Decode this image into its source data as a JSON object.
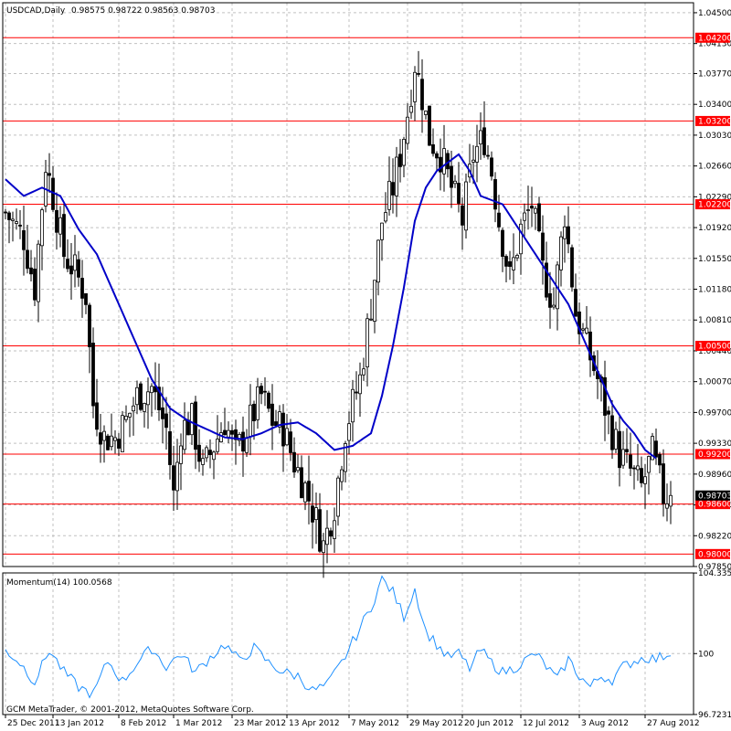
{
  "colors": {
    "background": "#ffffff",
    "grid": "#c0c0c0",
    "candle": "#000000",
    "moving_average": "#0000c8",
    "levels": "#ff0000",
    "momentum": "#1e90ff",
    "price_box": "#000000",
    "level_label_bg": "#ff0000",
    "level_label_text": "#ffffff"
  },
  "chart_data": [
    {
      "type": "candlestick",
      "title": "USDCAD,Daily",
      "ohlc_last": "0.98575 0.98722 0.98563 0.98703",
      "ylim": [
        0.9785,
        1.0462
      ],
      "y_ticks": [
        "1.04500",
        "1.04130",
        "1.03770",
        "1.03400",
        "1.03030",
        "1.02660",
        "1.02290",
        "1.01920",
        "1.01550",
        "1.01180",
        "1.00810",
        "1.00440",
        "1.00070",
        "0.99700",
        "0.99330",
        "0.98960",
        "0.98590",
        "0.98220",
        "0.97850"
      ],
      "x_ticks": [
        "25 Dec 2011",
        "13 Jan 2012",
        "8 Feb 2012",
        "1 Mar 2012",
        "23 Mar 2012",
        "13 Apr 2012",
        "7 May 2012",
        "29 May 2012",
        "20 Jun 2012",
        "12 Jul 2012",
        "3 Aug 2012",
        "27 Aug 2012"
      ],
      "x_tick_bar_index": [
        0,
        13,
        31,
        46,
        62,
        77,
        94,
        110,
        125,
        141,
        157,
        175
      ],
      "horizontal_levels": [
        {
          "value": 1.042,
          "label": "1.04200"
        },
        {
          "value": 1.032,
          "label": "1.03200"
        },
        {
          "value": 1.022,
          "label": "1.02200"
        },
        {
          "value": 1.005,
          "label": "1.00500"
        },
        {
          "value": 0.992,
          "label": "0.99200"
        },
        {
          "value": 0.986,
          "label": "0.98600"
        },
        {
          "value": 0.98,
          "label": "0.98000"
        }
      ],
      "current_price": {
        "value": 0.98703,
        "label": "0.98703"
      },
      "close_keypoints": [
        [
          0,
          1.021
        ],
        [
          5,
          1.018
        ],
        [
          8,
          1.012
        ],
        [
          11,
          1.027
        ],
        [
          13,
          1.023
        ],
        [
          16,
          1.016
        ],
        [
          19,
          1.014
        ],
        [
          22,
          1.011
        ],
        [
          24,
          0.998
        ],
        [
          27,
          0.994
        ],
        [
          30,
          0.994
        ],
        [
          33,
          0.996
        ],
        [
          36,
          0.999
        ],
        [
          40,
          1.0
        ],
        [
          44,
          0.995
        ],
        [
          46,
          0.987
        ],
        [
          48,
          0.995
        ],
        [
          51,
          0.996
        ],
        [
          54,
          0.99
        ],
        [
          57,
          0.993
        ],
        [
          60,
          0.996
        ],
        [
          63,
          0.992
        ],
        [
          66,
          0.995
        ],
        [
          70,
          0.999
        ],
        [
          73,
          0.996
        ],
        [
          76,
          0.995
        ],
        [
          79,
          0.991
        ],
        [
          82,
          0.988
        ],
        [
          85,
          0.984
        ],
        [
          87,
          0.981
        ],
        [
          90,
          0.986
        ],
        [
          93,
          0.995
        ],
        [
          97,
          1.001
        ],
        [
          100,
          1.01
        ],
        [
          103,
          1.02
        ],
        [
          106,
          1.024
        ],
        [
          108,
          1.028
        ],
        [
          110,
          1.033
        ],
        [
          112,
          1.039
        ],
        [
          114,
          1.035
        ],
        [
          116,
          1.03
        ],
        [
          119,
          1.028
        ],
        [
          122,
          1.024
        ],
        [
          125,
          1.02
        ],
        [
          128,
          1.028
        ],
        [
          131,
          1.03
        ],
        [
          133,
          1.026
        ],
        [
          135,
          1.02
        ],
        [
          138,
          1.013
        ],
        [
          141,
          1.019
        ],
        [
          144,
          1.022
        ],
        [
          147,
          1.014
        ],
        [
          150,
          1.01
        ],
        [
          153,
          1.021
        ],
        [
          156,
          1.009
        ],
        [
          159,
          1.005
        ],
        [
          162,
          1.001
        ],
        [
          165,
          0.996
        ],
        [
          168,
          0.992
        ],
        [
          171,
          0.99
        ],
        [
          174,
          0.988
        ],
        [
          177,
          0.992
        ],
        [
          180,
          0.987
        ],
        [
          182,
          0.98703
        ]
      ],
      "moving_average_keypoints": [
        [
          0,
          1.025
        ],
        [
          5,
          1.023
        ],
        [
          10,
          1.024
        ],
        [
          15,
          1.023
        ],
        [
          20,
          1.019
        ],
        [
          25,
          1.016
        ],
        [
          30,
          1.011
        ],
        [
          35,
          1.006
        ],
        [
          40,
          1.001
        ],
        [
          45,
          0.9975
        ],
        [
          50,
          0.996
        ],
        [
          55,
          0.995
        ],
        [
          60,
          0.994
        ],
        [
          65,
          0.9938
        ],
        [
          70,
          0.9945
        ],
        [
          75,
          0.9955
        ],
        [
          80,
          0.9958
        ],
        [
          85,
          0.9945
        ],
        [
          90,
          0.9925
        ],
        [
          95,
          0.993
        ],
        [
          100,
          0.9945
        ],
        [
          103,
          0.999
        ],
        [
          106,
          1.005
        ],
        [
          109,
          1.012
        ],
        [
          112,
          1.02
        ],
        [
          115,
          1.024
        ],
        [
          118,
          1.026
        ],
        [
          121,
          1.027
        ],
        [
          124,
          1.028
        ],
        [
          127,
          1.026
        ],
        [
          130,
          1.023
        ],
        [
          133,
          1.0225
        ],
        [
          136,
          1.022
        ],
        [
          139,
          1.02
        ],
        [
          142,
          1.018
        ],
        [
          145,
          1.016
        ],
        [
          148,
          1.014
        ],
        [
          151,
          1.012
        ],
        [
          154,
          1.01
        ],
        [
          157,
          1.007
        ],
        [
          160,
          1.004
        ],
        [
          163,
          1.001
        ],
        [
          166,
          0.998
        ],
        [
          169,
          0.996
        ],
        [
          172,
          0.9945
        ],
        [
          175,
          0.9925
        ],
        [
          178,
          0.9915
        ]
      ],
      "watermark": "GCM MetaTrader, © 2001-2012, MetaQuotes Software Corp."
    },
    {
      "type": "line",
      "title": "Momentum(14) 100.0568",
      "ylim": [
        96.72,
        104.34
      ],
      "y_ticks": [
        "104.3356",
        "100",
        "96.7231"
      ],
      "keypoints": [
        [
          0,
          100.2
        ],
        [
          4,
          99.5
        ],
        [
          8,
          98.5
        ],
        [
          12,
          100.2
        ],
        [
          16,
          99.0
        ],
        [
          20,
          98.2
        ],
        [
          24,
          97.8
        ],
        [
          28,
          99.6
        ],
        [
          32,
          98.5
        ],
        [
          36,
          99.5
        ],
        [
          40,
          100.3
        ],
        [
          44,
          99.3
        ],
        [
          48,
          100.0
        ],
        [
          52,
          99.0
        ],
        [
          56,
          99.8
        ],
        [
          60,
          100.5
        ],
        [
          64,
          99.6
        ],
        [
          68,
          100.3
        ],
        [
          72,
          99.5
        ],
        [
          76,
          99.0
        ],
        [
          80,
          98.8
        ],
        [
          84,
          98.0
        ],
        [
          88,
          98.3
        ],
        [
          92,
          99.5
        ],
        [
          96,
          101.0
        ],
        [
          100,
          102.5
        ],
        [
          103,
          104.0
        ],
        [
          106,
          103.3
        ],
        [
          109,
          102.0
        ],
        [
          112,
          103.5
        ],
        [
          115,
          101.2
        ],
        [
          118,
          100.5
        ],
        [
          121,
          99.8
        ],
        [
          124,
          100.0
        ],
        [
          127,
          99.2
        ],
        [
          130,
          100.2
        ],
        [
          133,
          99.5
        ],
        [
          136,
          99.0
        ],
        [
          139,
          99.2
        ],
        [
          142,
          99.6
        ],
        [
          145,
          100.0
        ],
        [
          148,
          99.3
        ],
        [
          151,
          98.6
        ],
        [
          154,
          99.7
        ],
        [
          157,
          98.8
        ],
        [
          160,
          98.2
        ],
        [
          163,
          98.8
        ],
        [
          166,
          98.6
        ],
        [
          169,
          99.3
        ],
        [
          172,
          99.6
        ],
        [
          175,
          99.8
        ],
        [
          178,
          99.7
        ],
        [
          182,
          100.06
        ]
      ]
    }
  ]
}
